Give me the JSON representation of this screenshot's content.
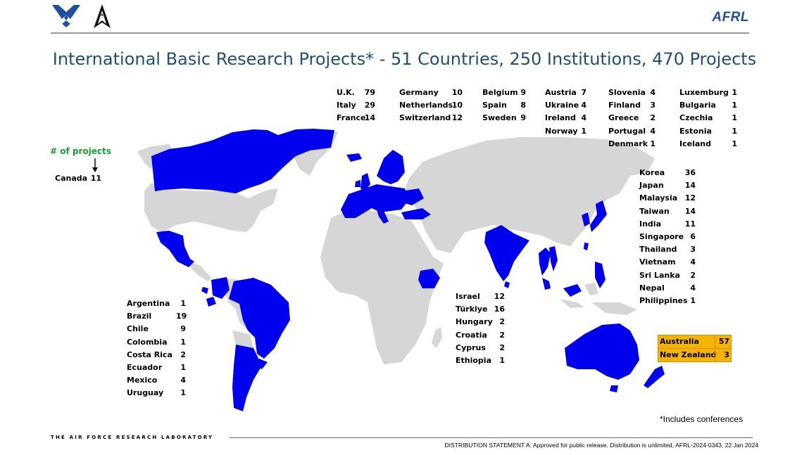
{
  "header": {
    "brand": "AFRL"
  },
  "title": "International Basic Research Projects* - 51 Countries, 250 Institutions, 470 Projects",
  "legend": {
    "label": "# of projects"
  },
  "canada": {
    "name": "Canada",
    "count": "11"
  },
  "europe": [
    [
      {
        "name": "U.K.",
        "count": "79"
      },
      {
        "name": "Italy",
        "count": "29"
      },
      {
        "name": "France",
        "count": "14"
      }
    ],
    [
      {
        "name": "Germany",
        "count": "10"
      },
      {
        "name": "Netherlands",
        "count": "10"
      },
      {
        "name": "Switzerland",
        "count": "12"
      }
    ],
    [
      {
        "name": "Belgium",
        "count": "9"
      },
      {
        "name": "Spain",
        "count": "8"
      },
      {
        "name": "Sweden",
        "count": "9"
      }
    ],
    [
      {
        "name": "Austria",
        "count": "7"
      },
      {
        "name": "Ukraine",
        "count": "4"
      },
      {
        "name": "Ireland",
        "count": "4"
      },
      {
        "name": "Norway",
        "count": "1"
      }
    ],
    [
      {
        "name": "Slovenia",
        "count": "4"
      },
      {
        "name": "Finland",
        "count": "3"
      },
      {
        "name": "Greece",
        "count": "2"
      },
      {
        "name": "Portugal",
        "count": "4"
      },
      {
        "name": "Denmark",
        "count": "1"
      }
    ],
    [
      {
        "name": "Luxemburg",
        "count": "1"
      },
      {
        "name": "Bulgaria",
        "count": "1"
      },
      {
        "name": "Czechia",
        "count": "1"
      },
      {
        "name": "Estonia",
        "count": "1"
      },
      {
        "name": "Iceland",
        "count": "1"
      }
    ]
  ],
  "asia": [
    {
      "name": "Korea",
      "count": "36"
    },
    {
      "name": "Japan",
      "count": "14"
    },
    {
      "name": "Malaysia",
      "count": "12"
    },
    {
      "name": "Taiwan",
      "count": "14"
    },
    {
      "name": "India",
      "count": "11"
    },
    {
      "name": "Singapore",
      "count": "6"
    },
    {
      "name": "Thailand",
      "count": "3"
    },
    {
      "name": "Vietnam",
      "count": "4"
    },
    {
      "name": "Sri Lanka",
      "count": "2"
    },
    {
      "name": "Nepal",
      "count": "4"
    },
    {
      "name": "Philippines",
      "count": "1"
    }
  ],
  "middle_east": [
    {
      "name": "Israel",
      "count": "12"
    },
    {
      "name": "Türkiye",
      "count": "16"
    },
    {
      "name": "Hungary",
      "count": "2"
    },
    {
      "name": "Croatia",
      "count": "2"
    },
    {
      "name": "Cyprus",
      "count": "2"
    },
    {
      "name": "Ethiopia",
      "count": "1"
    }
  ],
  "latin_america": [
    {
      "name": "Argentina",
      "count": "1"
    },
    {
      "name": "Brazil",
      "count": "19"
    },
    {
      "name": "Chile",
      "count": "9"
    },
    {
      "name": "Colombia",
      "count": "1"
    },
    {
      "name": "Costa Rica",
      "count": "2"
    },
    {
      "name": "Ecuador",
      "count": "1"
    },
    {
      "name": "Mexico",
      "count": "4"
    },
    {
      "name": "Uruguay",
      "count": "1"
    }
  ],
  "oceania": [
    {
      "name": "Australia",
      "count": "57"
    },
    {
      "name": "New Zealand",
      "count": "3"
    }
  ],
  "colors": {
    "highlight_country": "#0000ee",
    "other_land": "#d6d6d6",
    "title": "#1f4e79",
    "oceania_bg": "#f5b400",
    "legend": "#1aa02c"
  },
  "footnote": "*Includes conferences",
  "footer": {
    "lab": "THE AIR FORCE RESEARCH LABORATORY",
    "distribution": "DISTRIBUTION STATEMENT A:  Approved for public release. Distribution is unlimited, AFRL-2024-0343, 22 Jan 2024"
  }
}
